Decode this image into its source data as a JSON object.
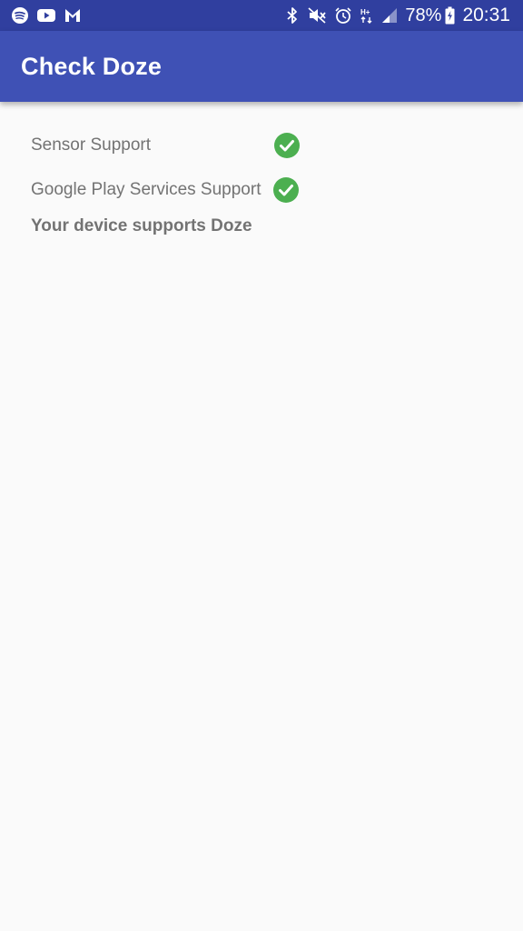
{
  "status_bar": {
    "battery": "78%",
    "time": "20:31",
    "left_icons": [
      "spotify-icon",
      "youtube-icon",
      "mail-icon"
    ],
    "right_icons": [
      "bluetooth-icon",
      "mute-icon",
      "alarm-icon",
      "data-icon",
      "signal-icon",
      "battery-icon"
    ],
    "color": "#303f9f"
  },
  "app_bar": {
    "title": "Check Doze",
    "color": "#3f51b5"
  },
  "checks": [
    {
      "label": "Sensor Support",
      "status": "supported",
      "icon": "check-circle-icon"
    },
    {
      "label": "Google Play Services Support",
      "status": "supported",
      "icon": "check-circle-icon"
    }
  ],
  "summary": "Your device supports Doze",
  "colors": {
    "check_green": "#4caf50",
    "text_gray": "#737373",
    "background": "#fafafa"
  }
}
